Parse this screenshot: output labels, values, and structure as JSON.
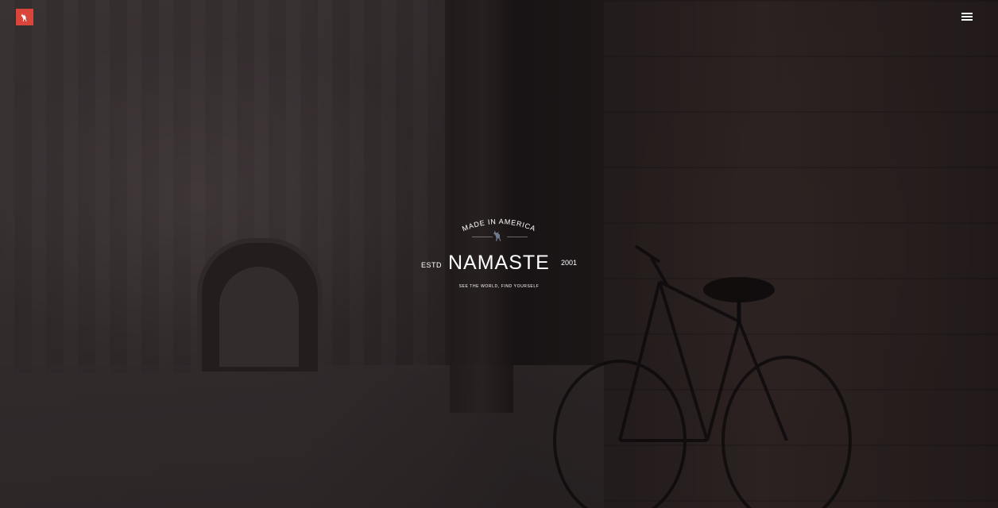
{
  "header": {
    "logo_icon": "deer-icon",
    "logo_color": "#d9453b",
    "menu_icon": "hamburger-menu-icon"
  },
  "hero": {
    "arc_text": "MADE IN AMERICA",
    "badge_icon": "deer-icon",
    "estd_label": "ESTD",
    "brand": "NAMASTE",
    "year": "2001",
    "tagline": "SEE THE WORLD, FIND YOURSELF"
  }
}
